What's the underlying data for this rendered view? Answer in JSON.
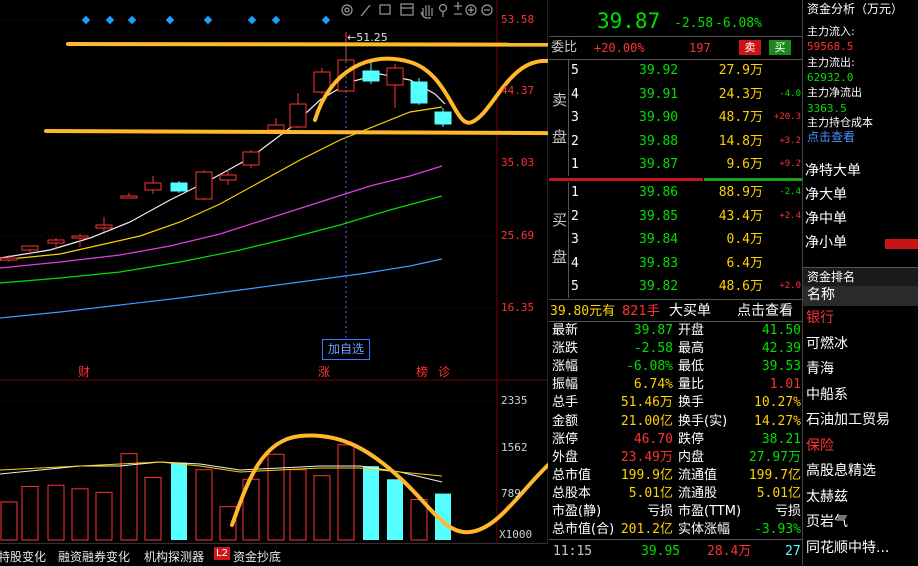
{
  "chart": {
    "price_levels": [
      "53.58",
      "44.37",
      "35.03",
      "25.69",
      "16.35"
    ],
    "volume_levels": [
      "2335",
      "1562",
      "789"
    ],
    "volume_unit": "X1000",
    "max_marker": "←51.25",
    "add_watch_button": "加自选",
    "event_markers": [
      "财",
      "涨",
      "榜",
      "诊"
    ],
    "volume_bars": [
      {
        "v": 640,
        "c": "red"
      },
      {
        "v": 900,
        "c": "red"
      },
      {
        "v": 920,
        "c": "red"
      },
      {
        "v": 860,
        "c": "red"
      },
      {
        "v": 800,
        "c": "red"
      },
      {
        "v": 1450,
        "c": "red"
      },
      {
        "v": 1050,
        "c": "red"
      },
      {
        "v": 1300,
        "c": "cyan"
      },
      {
        "v": 1180,
        "c": "red"
      },
      {
        "v": 560,
        "c": "red"
      },
      {
        "v": 1020,
        "c": "red"
      },
      {
        "v": 1440,
        "c": "red"
      },
      {
        "v": 1180,
        "c": "red"
      },
      {
        "v": 1080,
        "c": "red"
      },
      {
        "v": 1600,
        "c": "red"
      },
      {
        "v": 1240,
        "c": "cyan"
      },
      {
        "v": 1020,
        "c": "cyan"
      },
      {
        "v": 680,
        "c": "red"
      },
      {
        "v": 780,
        "c": "cyan"
      }
    ]
  },
  "tabs": [
    "特股变化",
    "融资融券变化",
    "机构探测器",
    "L2",
    "资金抄底"
  ],
  "quote": {
    "price": "39.87",
    "change": "-2.58",
    "change_pct": "-6.08%",
    "wei_bi_label": "委比",
    "wei_bi_value": "+20.00%",
    "wei_cha": "197",
    "sell_btn": "卖",
    "buy_btn": "买"
  },
  "sell_label": [
    "卖",
    "盘"
  ],
  "buy_label": [
    "买",
    "盘"
  ],
  "asks": [
    {
      "level": "5",
      "price": "39.92",
      "vol": "27.9万",
      "chg": ""
    },
    {
      "level": "4",
      "price": "39.91",
      "vol": "24.3万",
      "chg": "-4.0"
    },
    {
      "level": "3",
      "price": "39.90",
      "vol": "48.7万",
      "chg": "+20.3"
    },
    {
      "level": "2",
      "price": "39.88",
      "vol": "14.8万",
      "chg": "+3.2"
    },
    {
      "level": "1",
      "price": "39.87",
      "vol": "9.6万",
      "chg": "+9.2"
    }
  ],
  "bids": [
    {
      "level": "1",
      "price": "39.86",
      "vol": "88.9万",
      "chg": "-2.4"
    },
    {
      "level": "2",
      "price": "39.85",
      "vol": "43.4万",
      "chg": "+2.4"
    },
    {
      "level": "3",
      "price": "39.84",
      "vol": "0.4万",
      "chg": ""
    },
    {
      "level": "4",
      "price": "39.83",
      "vol": "6.4万",
      "chg": ""
    },
    {
      "level": "5",
      "price": "39.82",
      "vol": "48.6万",
      "chg": "+2.0"
    }
  ],
  "big_order": {
    "price": "39.80元有",
    "qty": "821手",
    "label": "大买单",
    "link": "点击查看"
  },
  "stats": [
    {
      "l1": "最新",
      "v1": "39.87",
      "c1": "grn",
      "l2": "开盘",
      "v2": "41.50",
      "c2": "grn"
    },
    {
      "l1": "涨跌",
      "v1": "-2.58",
      "c1": "grn",
      "l2": "最高",
      "v2": "42.39",
      "c2": "grn"
    },
    {
      "l1": "涨幅",
      "v1": "-6.08%",
      "c1": "grn",
      "l2": "最低",
      "v2": "39.53",
      "c2": "grn"
    },
    {
      "l1": "振幅",
      "v1": "6.74%",
      "c1": "yel",
      "l2": "量比",
      "v2": "1.01",
      "c2": "red"
    },
    {
      "l1": "总手",
      "v1": "51.46万",
      "c1": "yel",
      "l2": "换手",
      "v2": "10.27%",
      "c2": "yel"
    },
    {
      "l1": "金额",
      "v1": "21.00亿",
      "c1": "yel",
      "l2": "换手(实)",
      "v2": "14.27%",
      "c2": "yel"
    },
    {
      "l1": "涨停",
      "v1": "46.70",
      "c1": "red",
      "l2": "跌停",
      "v2": "38.21",
      "c2": "grn"
    },
    {
      "l1": "外盘",
      "v1": "23.49万",
      "c1": "red",
      "l2": "内盘",
      "v2": "27.97万",
      "c2": "grn"
    },
    {
      "l1": "总市值",
      "v1": "199.9亿",
      "c1": "yel",
      "l2": "流通值",
      "v2": "199.7亿",
      "c2": "yel"
    },
    {
      "l1": "总股本",
      "v1": "5.01亿",
      "c1": "yel",
      "l2": "流通股",
      "v2": "5.01亿",
      "c2": "yel"
    },
    {
      "l1": "市盈(静)",
      "v1": "亏损",
      "c1": "wht",
      "l2": "市盈(TTM)",
      "v2": "亏损",
      "c2": "wht"
    },
    {
      "l1": "总市值(合)",
      "v1": "201.2亿",
      "c1": "yel",
      "l2": "实体涨幅",
      "v2": "-3.93%",
      "c2": "grn"
    }
  ],
  "trade_row": {
    "time": "11:15",
    "price": "39.95",
    "vol": "28.4万",
    "num": "27"
  },
  "fund": {
    "title": "资金分析（万元）",
    "inflow_label": "主力流入:",
    "inflow": "59568.5",
    "outflow_label": "主力流出:",
    "outflow": "62932.0",
    "net_label": "主力净流出",
    "net": "3363.5",
    "cost_label": "主力持仓成本",
    "link": "点击查看",
    "net_items": [
      "净特大单",
      "净大单",
      "净中单",
      "净小单"
    ]
  },
  "ranking": {
    "title": "资金排名",
    "header": "名称",
    "items": [
      {
        "name": "银行",
        "color": "red"
      },
      {
        "name": "可燃冰",
        "color": "wht"
      },
      {
        "name": "青海",
        "color": "wht"
      },
      {
        "name": "中船系",
        "color": "wht"
      },
      {
        "name": "石油加工贸易",
        "color": "wht"
      },
      {
        "name": "保险",
        "color": "red"
      },
      {
        "name": "高股息精选",
        "color": "wht"
      },
      {
        "name": "太赫兹",
        "color": "wht"
      },
      {
        "name": "页岩气",
        "color": "wht"
      },
      {
        "name": "同花顺中特...",
        "color": "wht"
      }
    ]
  },
  "colors": {
    "up": "#ff3232",
    "down": "#55ffff",
    "ma5": "#f0f0f0",
    "ma10": "#ffd200",
    "ma20": "#e040e0",
    "ma30": "#00e000",
    "ma60": "#3c9cff",
    "overlay": "#ffb72b"
  }
}
